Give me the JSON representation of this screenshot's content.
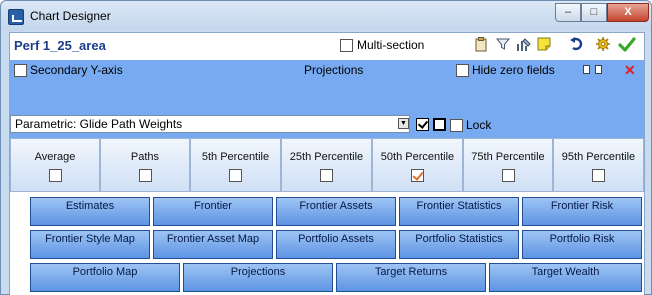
{
  "window": {
    "title": "Chart Designer",
    "min_label": "–",
    "max_label": "□",
    "close_label": "X"
  },
  "toolbar": {
    "perf_name": "Perf 1_25_area",
    "multi_section_label": "Multi-section",
    "multi_section_checked": false,
    "icons": [
      "clipboard-icon",
      "filter-icon",
      "edit-chart-icon",
      "note-icon",
      "undo-icon",
      "settings-gear-icon",
      "checkmark-icon"
    ]
  },
  "panel": {
    "secondary_y_label": "Secondary Y-axis",
    "secondary_y_checked": false,
    "title": "Projections",
    "hide_zero_label": "Hide zero fields",
    "hide_zero_checked": false,
    "close_glyph": "✕"
  },
  "parametric": {
    "selected": "Parametric: Glide Path Weights",
    "lock_label": "Lock",
    "lock_checked": false,
    "box1_checked": true,
    "box2_checked": false
  },
  "percentiles": [
    {
      "label": "Average",
      "checked": false
    },
    {
      "label": "Paths",
      "checked": false
    },
    {
      "label": "5th Percentile",
      "checked": false
    },
    {
      "label": "25th Percentile",
      "checked": false
    },
    {
      "label": "50th Percentile",
      "checked": true
    },
    {
      "label": "75th Percentile",
      "checked": false
    },
    {
      "label": "95th Percentile",
      "checked": false
    }
  ],
  "nav_rows": [
    [
      "Estimates",
      "Frontier",
      "Frontier Assets",
      "Frontier Statistics",
      "Frontier Risk"
    ],
    [
      "Frontier Style Map",
      "Frontier Asset Map",
      "Portfolio Assets",
      "Portfolio Statistics",
      "Portfolio Risk"
    ],
    [
      "Portfolio Map",
      "Projections",
      "Target Returns",
      "Target Wealth"
    ]
  ],
  "colors": {
    "panel_blue": "#77aaf0",
    "button_blue": "#6fa0e8",
    "title_blue": "#1c3d8c",
    "close_red": "#e02020"
  }
}
